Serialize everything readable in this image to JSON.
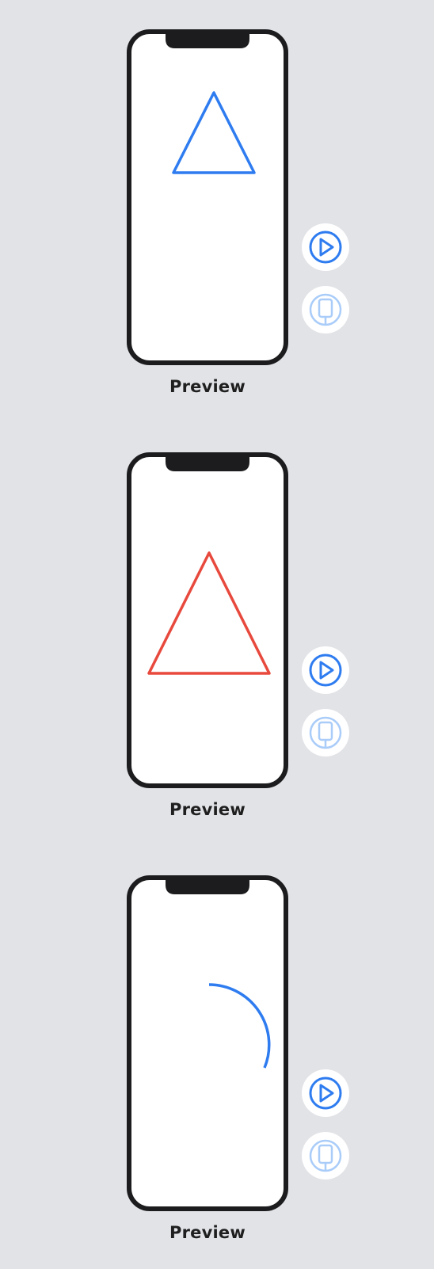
{
  "colors": {
    "background": "#e2e3e7",
    "phone_frame": "#1c1c1e",
    "screen": "#ffffff",
    "accent_blue": "#2e7cf0",
    "accent_red": "#e8493d",
    "device_icon_faded": "#a9ccf9"
  },
  "previews": [
    {
      "label": "Preview",
      "shape": "triangle",
      "shape_color": "#2e7cf0",
      "icons": {
        "play": "play-circle-icon",
        "device": "device-icon"
      }
    },
    {
      "label": "Preview",
      "shape": "triangle",
      "shape_color": "#e8493d",
      "icons": {
        "play": "play-circle-icon",
        "device": "device-icon"
      }
    },
    {
      "label": "Preview",
      "shape": "arc",
      "shape_color": "#2e7cf0",
      "icons": {
        "play": "play-circle-icon",
        "device": "device-icon"
      }
    }
  ]
}
